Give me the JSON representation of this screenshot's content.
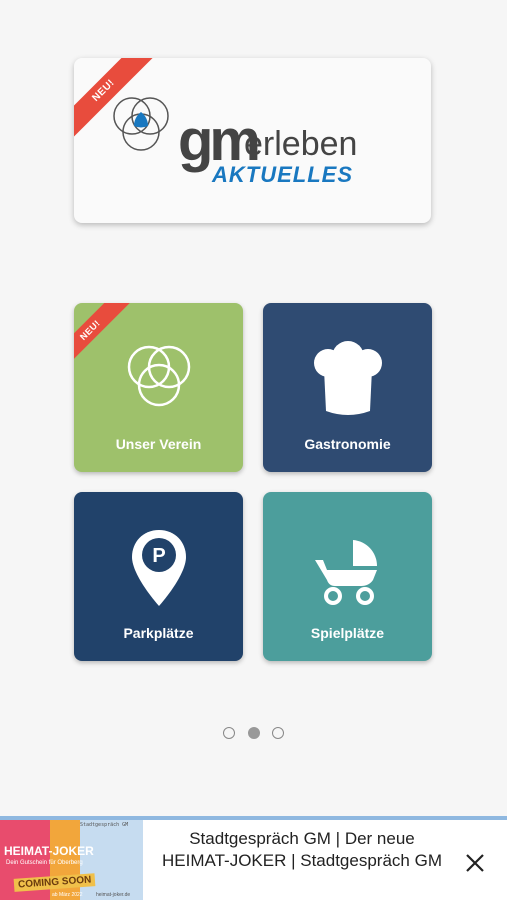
{
  "hero": {
    "badge": "NEU!",
    "brand_gm": "gm",
    "brand_erleben": "erleben",
    "brand_subtitle": "AKTUELLES"
  },
  "tiles": [
    {
      "label": "Unser Verein",
      "icon": "circles-icon",
      "badge": "NEU!",
      "color": "#9ec16b"
    },
    {
      "label": "Gastronomie",
      "icon": "chef-hat-icon",
      "color": "#2f4b72"
    },
    {
      "label": "Parkplätze",
      "icon": "parking-pin-icon",
      "color": "#21426a"
    },
    {
      "label": "Spielplätze",
      "icon": "stroller-icon",
      "color": "#4c9e9c"
    }
  ],
  "pager": {
    "pages": 3,
    "active": 2
  },
  "ad": {
    "title": "Stadtgespräch GM | Der neue HEIMAT-JOKER | Stadtgespräch GM",
    "image_title": "HEIMAT-JOKER",
    "image_subtitle": "Dein Gutschein für Oberberg",
    "image_badge": "COMING SOON",
    "image_top": "Stadtgespräch GM",
    "image_url": "heimat-joker.de",
    "image_date": "ab März 2022"
  },
  "colors": {
    "accent_blue": "#1978c0",
    "ribbon_red": "#e84c3d"
  }
}
